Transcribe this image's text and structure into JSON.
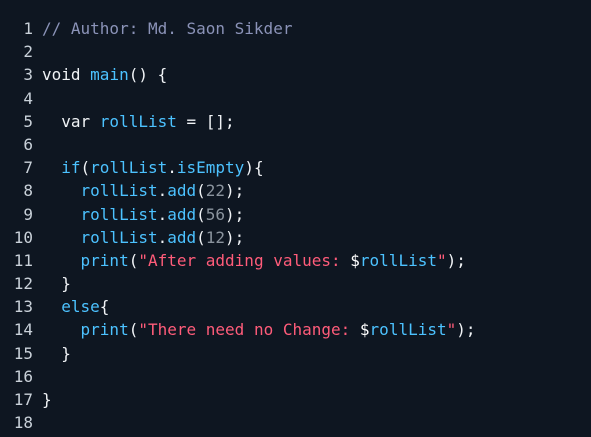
{
  "editor": {
    "lines": [
      {
        "n": "1",
        "tokens": [
          {
            "t": "// Author: Md. Saon Sikder",
            "c": "comment"
          }
        ]
      },
      {
        "n": "2",
        "tokens": []
      },
      {
        "n": "3",
        "tokens": [
          {
            "t": "void ",
            "c": "kw"
          },
          {
            "t": "main",
            "c": "fn"
          },
          {
            "t": "() {",
            "c": "punc"
          }
        ]
      },
      {
        "n": "4",
        "tokens": []
      },
      {
        "n": "5",
        "tokens": [
          {
            "t": "  var ",
            "c": "kw"
          },
          {
            "t": "rollList",
            "c": "var"
          },
          {
            "t": " = [];",
            "c": "punc"
          }
        ]
      },
      {
        "n": "6",
        "tokens": []
      },
      {
        "n": "7",
        "tokens": [
          {
            "t": "  if",
            "c": "fn"
          },
          {
            "t": "(",
            "c": "punc"
          },
          {
            "t": "rollList",
            "c": "var"
          },
          {
            "t": ".",
            "c": "punc"
          },
          {
            "t": "isEmpty",
            "c": "fn"
          },
          {
            "t": "){",
            "c": "punc"
          }
        ]
      },
      {
        "n": "8",
        "tokens": [
          {
            "t": "    ",
            "c": "plain"
          },
          {
            "t": "rollList",
            "c": "var"
          },
          {
            "t": ".",
            "c": "punc"
          },
          {
            "t": "add",
            "c": "fn"
          },
          {
            "t": "(",
            "c": "punc"
          },
          {
            "t": "22",
            "c": "num"
          },
          {
            "t": ");",
            "c": "punc"
          }
        ]
      },
      {
        "n": "9",
        "tokens": [
          {
            "t": "    ",
            "c": "plain"
          },
          {
            "t": "rollList",
            "c": "var"
          },
          {
            "t": ".",
            "c": "punc"
          },
          {
            "t": "add",
            "c": "fn"
          },
          {
            "t": "(",
            "c": "punc"
          },
          {
            "t": "56",
            "c": "num"
          },
          {
            "t": ");",
            "c": "punc"
          }
        ]
      },
      {
        "n": "10",
        "tokens": [
          {
            "t": "    ",
            "c": "plain"
          },
          {
            "t": "rollList",
            "c": "var"
          },
          {
            "t": ".",
            "c": "punc"
          },
          {
            "t": "add",
            "c": "fn"
          },
          {
            "t": "(",
            "c": "punc"
          },
          {
            "t": "12",
            "c": "num"
          },
          {
            "t": ");",
            "c": "punc"
          }
        ]
      },
      {
        "n": "11",
        "tokens": [
          {
            "t": "    ",
            "c": "plain"
          },
          {
            "t": "print",
            "c": "fn"
          },
          {
            "t": "(",
            "c": "punc"
          },
          {
            "t": "\"After adding values: ",
            "c": "str"
          },
          {
            "t": "$",
            "c": "interp"
          },
          {
            "t": "rollList",
            "c": "var"
          },
          {
            "t": "\"",
            "c": "str"
          },
          {
            "t": ");",
            "c": "punc"
          }
        ]
      },
      {
        "n": "12",
        "tokens": [
          {
            "t": "  }",
            "c": "punc"
          }
        ]
      },
      {
        "n": "13",
        "tokens": [
          {
            "t": "  else",
            "c": "fn"
          },
          {
            "t": "{",
            "c": "punc"
          }
        ]
      },
      {
        "n": "14",
        "tokens": [
          {
            "t": "    ",
            "c": "plain"
          },
          {
            "t": "print",
            "c": "fn"
          },
          {
            "t": "(",
            "c": "punc"
          },
          {
            "t": "\"There need no Change: ",
            "c": "str"
          },
          {
            "t": "$",
            "c": "interp"
          },
          {
            "t": "rollList",
            "c": "var"
          },
          {
            "t": "\"",
            "c": "str"
          },
          {
            "t": ");",
            "c": "punc"
          }
        ]
      },
      {
        "n": "15",
        "tokens": [
          {
            "t": "  }",
            "c": "punc"
          }
        ]
      },
      {
        "n": "16",
        "tokens": []
      },
      {
        "n": "17",
        "tokens": [
          {
            "t": "}",
            "c": "punc"
          }
        ]
      },
      {
        "n": "18",
        "tokens": []
      }
    ]
  },
  "colors": {
    "background": "#0e1621",
    "comment": "#8b93b8",
    "identifier": "#4cc2ff",
    "string": "#ff5c7a",
    "number": "#8b949e"
  }
}
